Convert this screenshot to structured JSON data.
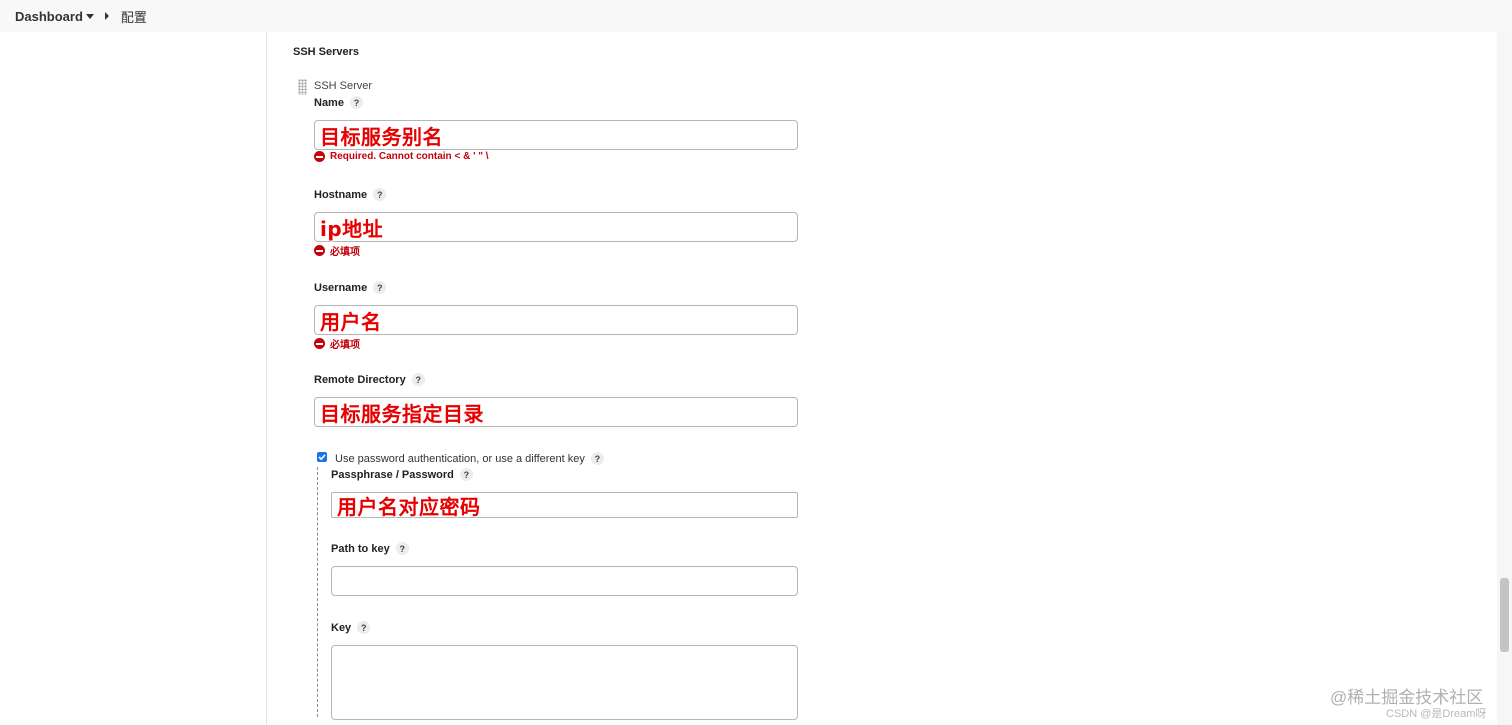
{
  "breadcrumb": {
    "dashboard": "Dashboard",
    "config": "配置"
  },
  "section": {
    "title": "SSH Servers",
    "block_title": "SSH Server"
  },
  "fields": {
    "name": {
      "label": "Name",
      "help": "?",
      "value": "目标服务别名",
      "error": "Required. Cannot contain < & ' \" \\"
    },
    "hostname": {
      "label": "Hostname",
      "help": "?",
      "value": "ip地址",
      "error": "必填项"
    },
    "username": {
      "label": "Username",
      "help": "?",
      "value": "用户名",
      "error": "必填项"
    },
    "remote_dir": {
      "label": "Remote Directory",
      "help": "?",
      "value": "目标服务指定目录"
    },
    "use_password": {
      "label": "Use password authentication, or use a different key",
      "help": "?",
      "checked": true
    },
    "passphrase": {
      "label": "Passphrase / Password",
      "help": "?",
      "value": "用户名对应密码"
    },
    "path_to_key": {
      "label": "Path to key",
      "help": "?",
      "value": ""
    },
    "key": {
      "label": "Key",
      "help": "?",
      "value": ""
    }
  },
  "watermark": {
    "line1": "@稀土掘金技术社区",
    "line2": "CSDN @是Dream呀"
  },
  "colors": {
    "error": "#c4000a",
    "annotation": "#e60000",
    "checkbox": "#1a73e8"
  }
}
